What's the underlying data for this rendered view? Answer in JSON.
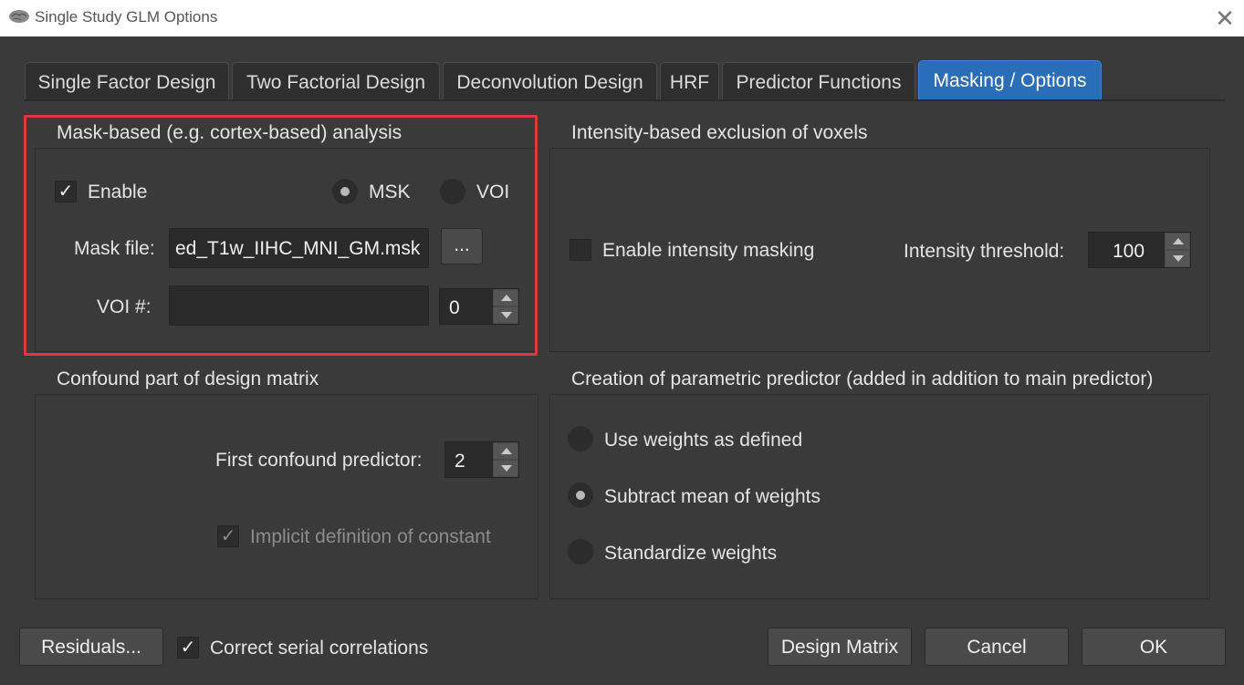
{
  "window": {
    "title": "Single Study GLM Options",
    "close_glyph": "✕"
  },
  "tabs": [
    {
      "label": "Single Factor Design"
    },
    {
      "label": "Two Factorial Design"
    },
    {
      "label": "Deconvolution Design"
    },
    {
      "label": "HRF"
    },
    {
      "label": "Predictor Functions"
    },
    {
      "label": "Masking / Options",
      "active": true
    }
  ],
  "mask_group": {
    "title": "Mask-based (e.g. cortex-based) analysis",
    "enable_label": "Enable",
    "enable_checked": true,
    "msk_label": "MSK",
    "msk_selected": true,
    "voi_label": "VOI",
    "voi_selected": false,
    "mask_file_label": "Mask file:",
    "mask_file_value": "ed_T1w_IIHC_MNI_GM.msk",
    "browse_label": "...",
    "voi_num_label": "VOI #:",
    "voi_field_value": "",
    "voi_spin_value": "0"
  },
  "intensity_group": {
    "title": "Intensity-based exclusion of voxels",
    "enable_label": "Enable intensity masking",
    "enable_checked": false,
    "threshold_label": "Intensity threshold:",
    "threshold_value": "100"
  },
  "confound_group": {
    "title": "Confound part of design matrix",
    "first_predictor_label": "First confound predictor:",
    "first_predictor_value": "2",
    "implicit_label": "Implicit definition of constant",
    "implicit_checked": true,
    "implicit_enabled": false
  },
  "parametric_group": {
    "title": "Creation of parametric predictor (added in addition  to main predictor)",
    "options": [
      {
        "label": "Use weights as defined",
        "selected": false
      },
      {
        "label": "Subtract mean of weights",
        "selected": true
      },
      {
        "label": "Standardize weights",
        "selected": false
      }
    ]
  },
  "footer": {
    "residuals_label": "Residuals...",
    "serial_label": "Correct serial correlations",
    "serial_checked": true,
    "design_matrix_label": "Design Matrix",
    "cancel_label": "Cancel",
    "ok_label": "OK"
  },
  "check_glyph": "✓",
  "colors": {
    "accent": "#2a6db8",
    "highlight": "#e0373e",
    "background": "#3a3a3a"
  }
}
